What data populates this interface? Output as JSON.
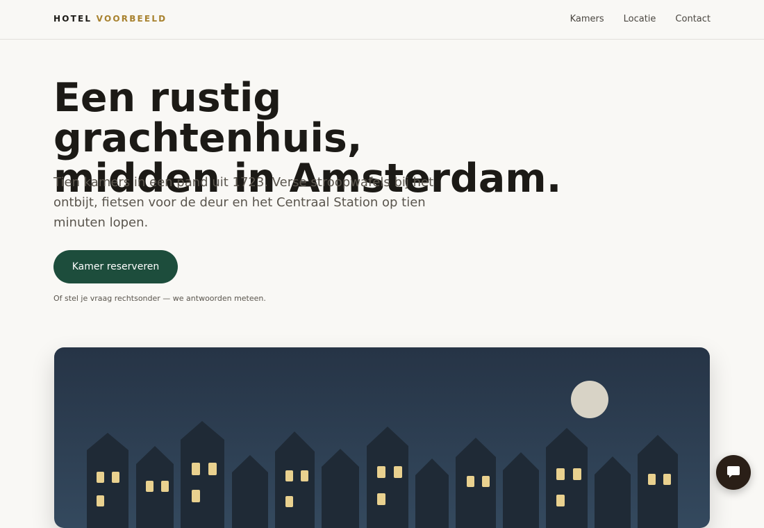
{
  "brand": {
    "first": "HOTEL",
    "second": "VOORBEELD"
  },
  "nav": {
    "items": [
      "Kamers",
      "Locatie",
      "Contact"
    ]
  },
  "hero": {
    "title_line1": "Een rustig grachtenhuis,",
    "title_line2": "midden in Amsterdam.",
    "lead": "Tien kamers in een pand uit 1723. Verse stroopwafels bij het ontbijt, fietsen voor de deur en het Centraal Station op tien minuten lopen.",
    "cta_label": "Kamer reserveren",
    "hint": "Of stel je vraag rechtsonder — we antwoorden meteen."
  },
  "colors": {
    "accent": "#a8822f",
    "cta": "#1d4d3c",
    "sky_top": "#263446",
    "sky_bottom": "#34495e",
    "building": "#1f2a36",
    "window": "#e9d18f",
    "moon": "#d8d3c6",
    "chat": "#2a1f17"
  },
  "icons": {
    "chat": "chat-bubble-icon"
  }
}
